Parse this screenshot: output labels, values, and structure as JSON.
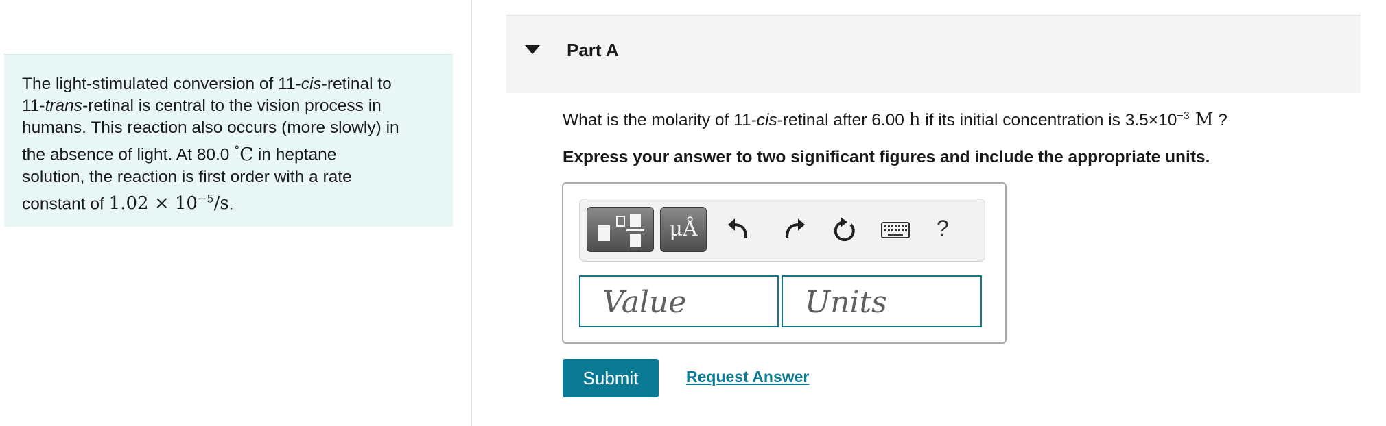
{
  "intro": {
    "line1_a": "The light-stimulated conversion of 11-",
    "line1_b": "cis",
    "line1_c": "-retinal to",
    "line2_a": "11-",
    "line2_b": "trans",
    "line2_c": "-retinal is central to the vision process in",
    "line3": "humans. This reaction also occurs (more slowly) in",
    "line4_a": "the absence of light. At 80.0 ",
    "line4_deg": "°",
    "line4_unit": "C",
    "line4_b": " in heptane",
    "line5": "solution, the reaction is first order with a rate",
    "line6_a": "constant of ",
    "rate_mantissa": "1.02 × 10",
    "rate_exp": "−5",
    "rate_unit": "/s",
    "line6_end": "."
  },
  "part": {
    "title": "Part A"
  },
  "question": {
    "a": "What is the molarity of 11-",
    "b": "cis",
    "c": "-retinal after 6.00 ",
    "time_unit": "h",
    "d": " if its initial concentration is 3.5×10",
    "exp": "−3",
    "conc_unit": " M",
    "e": " ?"
  },
  "instruction": "Express your answer to two significant figures and include the appropriate units.",
  "toolbar": {
    "templates_icon": "templates-icon",
    "units_label": "μÅ",
    "undo_icon": "undo-icon",
    "redo_icon": "redo-icon",
    "reset_icon": "reset-icon",
    "keyboard_icon": "keyboard-icon",
    "help_label": "?"
  },
  "inputs": {
    "value_placeholder": "Value",
    "units_placeholder": "Units"
  },
  "actions": {
    "submit": "Submit",
    "request": "Request Answer"
  },
  "colors": {
    "accent": "#0a7a95",
    "intro_bg": "#e8f6f6",
    "header_bg": "#f4f4f4"
  }
}
